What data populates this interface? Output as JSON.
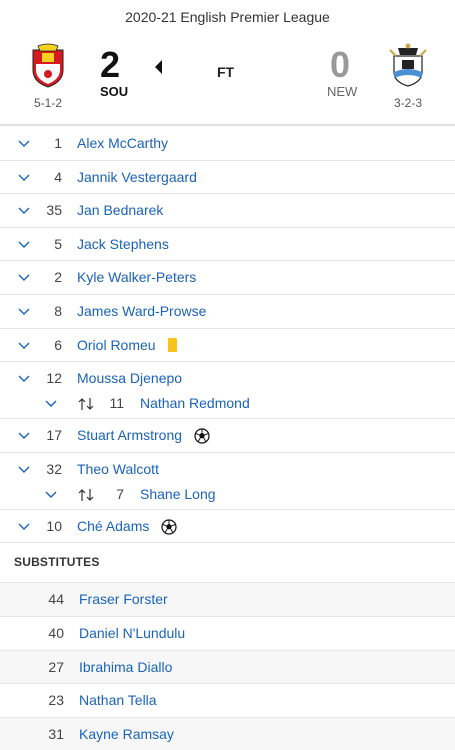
{
  "match": {
    "league": "2020-21 English Premier League",
    "status": "FT",
    "home": {
      "abbr": "SOU",
      "score": "2",
      "formation": "5-1-2",
      "crest": "southampton-crest-icon"
    },
    "away": {
      "abbr": "NEW",
      "score": "0",
      "formation": "3-2-3",
      "crest": "newcastle-crest-icon"
    }
  },
  "lineup": [
    {
      "number": "1",
      "name": "Alex McCarthy"
    },
    {
      "number": "4",
      "name": "Jannik Vestergaard"
    },
    {
      "number": "35",
      "name": "Jan Bednarek"
    },
    {
      "number": "5",
      "name": "Jack Stephens"
    },
    {
      "number": "2",
      "name": "Kyle Walker-Peters"
    },
    {
      "number": "8",
      "name": "James Ward-Prowse"
    },
    {
      "number": "6",
      "name": "Oriol Romeu",
      "icon": "yellow-card"
    },
    {
      "number": "12",
      "name": "Moussa Djenepo",
      "sub": {
        "number": "11",
        "name": "Nathan Redmond"
      }
    },
    {
      "number": "17",
      "name": "Stuart Armstrong",
      "icon": "goal"
    },
    {
      "number": "32",
      "name": "Theo Walcott",
      "sub": {
        "number": "7",
        "name": "Shane Long"
      }
    },
    {
      "number": "10",
      "name": "Ché Adams",
      "icon": "goal"
    }
  ],
  "substitutes": {
    "heading": "SUBSTITUTES",
    "players": [
      {
        "number": "44",
        "name": "Fraser Forster"
      },
      {
        "number": "40",
        "name": "Daniel N'Lundulu"
      },
      {
        "number": "27",
        "name": "Ibrahima Diallo"
      },
      {
        "number": "23",
        "name": "Nathan Tella"
      },
      {
        "number": "31",
        "name": "Kayne Ramsay"
      }
    ]
  },
  "colors": {
    "link": "#1a63b8",
    "yellow_card": "#f6c21b"
  }
}
